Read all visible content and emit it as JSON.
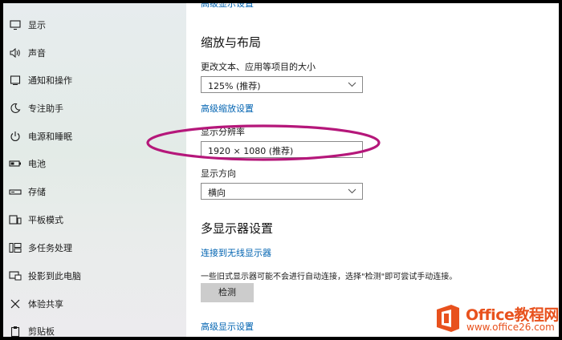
{
  "sidebar": {
    "items": [
      {
        "label": "显示",
        "icon": "monitor-icon"
      },
      {
        "label": "声音",
        "icon": "speaker-icon"
      },
      {
        "label": "通知和操作",
        "icon": "notification-icon"
      },
      {
        "label": "专注助手",
        "icon": "moon-icon"
      },
      {
        "label": "电源和睡眠",
        "icon": "power-icon"
      },
      {
        "label": "电池",
        "icon": "battery-icon"
      },
      {
        "label": "存储",
        "icon": "storage-icon"
      },
      {
        "label": "平板模式",
        "icon": "tablet-icon"
      },
      {
        "label": "多任务处理",
        "icon": "multitask-icon"
      },
      {
        "label": "投影到此电脑",
        "icon": "project-icon"
      },
      {
        "label": "体验共享",
        "icon": "share-icon"
      },
      {
        "label": "剪贴板",
        "icon": "clipboard-icon"
      }
    ]
  },
  "main": {
    "top_cut_link": "高级显示设置",
    "scale_layout": {
      "heading": "缩放与布局",
      "text_size_label": "更改文本、应用等项目的大小",
      "text_size_value": "125% (推荐)",
      "advanced_scale_link": "高级缩放设置",
      "resolution_label": "显示分辨率",
      "resolution_value": "1920 × 1080 (推荐)",
      "orientation_label": "显示方向",
      "orientation_value": "横向"
    },
    "multi_display": {
      "heading": "多显示器设置",
      "wireless_link": "连接到无线显示器",
      "description": "一些旧式显示器可能不会进行自动连接，选择\"检测\"即可尝试手动连接。",
      "detect_button": "检测",
      "advanced_display_link": "高级显示设置"
    }
  },
  "annotation": {
    "color": "#b5177a"
  },
  "watermark": {
    "title": "Office教程网",
    "url": "www.office26.com",
    "color": "#e8511d"
  },
  "colors": {
    "accent_link": "#0063b1",
    "sidebar_bg": "#e7ecee"
  }
}
